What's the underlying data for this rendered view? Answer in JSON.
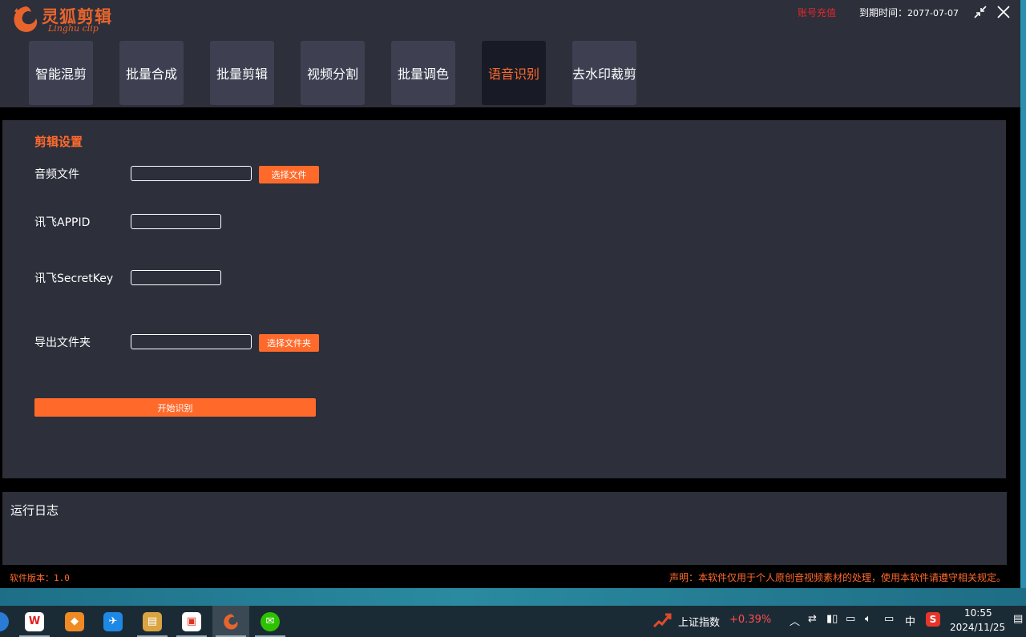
{
  "app": {
    "logo_title": "灵狐剪辑",
    "logo_subtitle": "Linghu clip",
    "recharge_label": "账号充值",
    "expiry_label": "到期时间：",
    "expiry_date": "2077-07-07",
    "brand_color": "#ff6a2b"
  },
  "tabs": [
    {
      "label": "智能混剪"
    },
    {
      "label": "批量合成"
    },
    {
      "label": "批量剪辑"
    },
    {
      "label": "视频分割"
    },
    {
      "label": "批量调色"
    },
    {
      "label": "语音识别",
      "active": true
    },
    {
      "label": "去水印裁剪"
    }
  ],
  "settings": {
    "title": "剪辑设置",
    "audio_label": "音频文件",
    "audio_value": "",
    "audio_button": "选择文件",
    "appid_label": "讯飞APPID",
    "appid_value": "",
    "secret_label": "讯飞SecretKey",
    "secret_value": "",
    "export_label": "导出文件夹",
    "export_value": "",
    "export_button": "选择文件夹",
    "start_button": "开始识别"
  },
  "log": {
    "title": "运行日志"
  },
  "footer": {
    "version": "软件版本：1.0",
    "disclaimer": "声明：本软件仅用于个人原创音视频素材的处理，使用本软件请遵守相关规定。"
  },
  "taskbar": {
    "apps": [
      {
        "icon": "wps-icon",
        "glyph": "W",
        "color": "#e02020"
      },
      {
        "icon": "orange-app-icon",
        "glyph": "◆",
        "color": "#f08a24"
      },
      {
        "icon": "blue-bird-icon",
        "glyph": "✈",
        "color": "#1e88e5"
      },
      {
        "icon": "archive-icon",
        "glyph": "▤",
        "color": "#d9a441"
      },
      {
        "icon": "red-app-icon",
        "glyph": "▣",
        "color": "#ffffff"
      },
      {
        "icon": "linghu-clip-icon",
        "glyph": "",
        "color": "#3a4954"
      },
      {
        "icon": "wechat-icon",
        "glyph": "✉",
        "color": "#2dc100"
      }
    ],
    "stock_name": "上证指数",
    "stock_change": "+0.39%",
    "ime": "中",
    "time": "10:55",
    "date": "2024/11/25"
  }
}
